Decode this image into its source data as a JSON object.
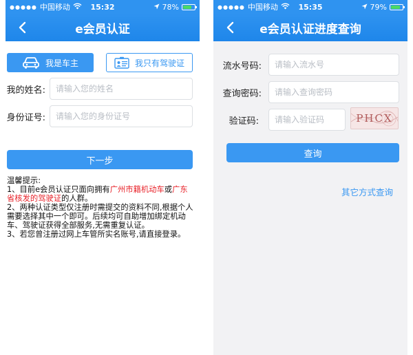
{
  "left": {
    "status": {
      "carrier": "中国移动",
      "time": "15:32",
      "battery": "78%",
      "battery_level": 0.78
    },
    "nav": {
      "title": "e会员认证"
    },
    "tabs": [
      {
        "label": "我是车主",
        "active": true,
        "icon": "car-icon"
      },
      {
        "label": "我只有驾驶证",
        "active": false,
        "icon": "license-card-icon"
      }
    ],
    "form": {
      "name": {
        "label": "我的姓名:",
        "placeholder": "请输入您的姓名",
        "value": ""
      },
      "id": {
        "label": "身份证号:",
        "placeholder": "请输入您的身份证号",
        "value": ""
      },
      "next_label": "下一步"
    },
    "tips": {
      "title": "温馨提示:",
      "line1_prefix": "1、目前e会员认证只面向拥有",
      "line1_red1": "广州市籍机动车",
      "line1_or": "或",
      "line1_red2": "广东省核发的驾驶证",
      "line1_suffix": "的人群。",
      "line2": "2、两种认证类型仅注册时需提交的资料不同,根据个人需要选择其中一个即可。后续均可自助增加绑定机动车、驾驶证获得全部服务,无需重复认证。",
      "line3": "3、若您曾注册过网上车管所实名账号,请直接登录。"
    }
  },
  "right": {
    "status": {
      "carrier": "中国移动",
      "time": "15:35",
      "battery": "79%",
      "battery_level": 0.79
    },
    "nav": {
      "title": "e会员认证进度查询"
    },
    "form": {
      "serial": {
        "label": "流水号码:",
        "placeholder": "请输入流水号",
        "value": ""
      },
      "password": {
        "label": "查询密码:",
        "placeholder": "请输入查询密码",
        "value": ""
      },
      "captcha": {
        "label": "验证码:",
        "placeholder": "请输入验证码",
        "value": "",
        "image_text": "PHCX"
      },
      "submit_label": "查询"
    },
    "other_link": "其它方式查询"
  },
  "colors": {
    "primary": "#3a98f2",
    "nav": "#2f93f0",
    "warning_red": "#e8232a",
    "battery_green": "#4cd964"
  }
}
